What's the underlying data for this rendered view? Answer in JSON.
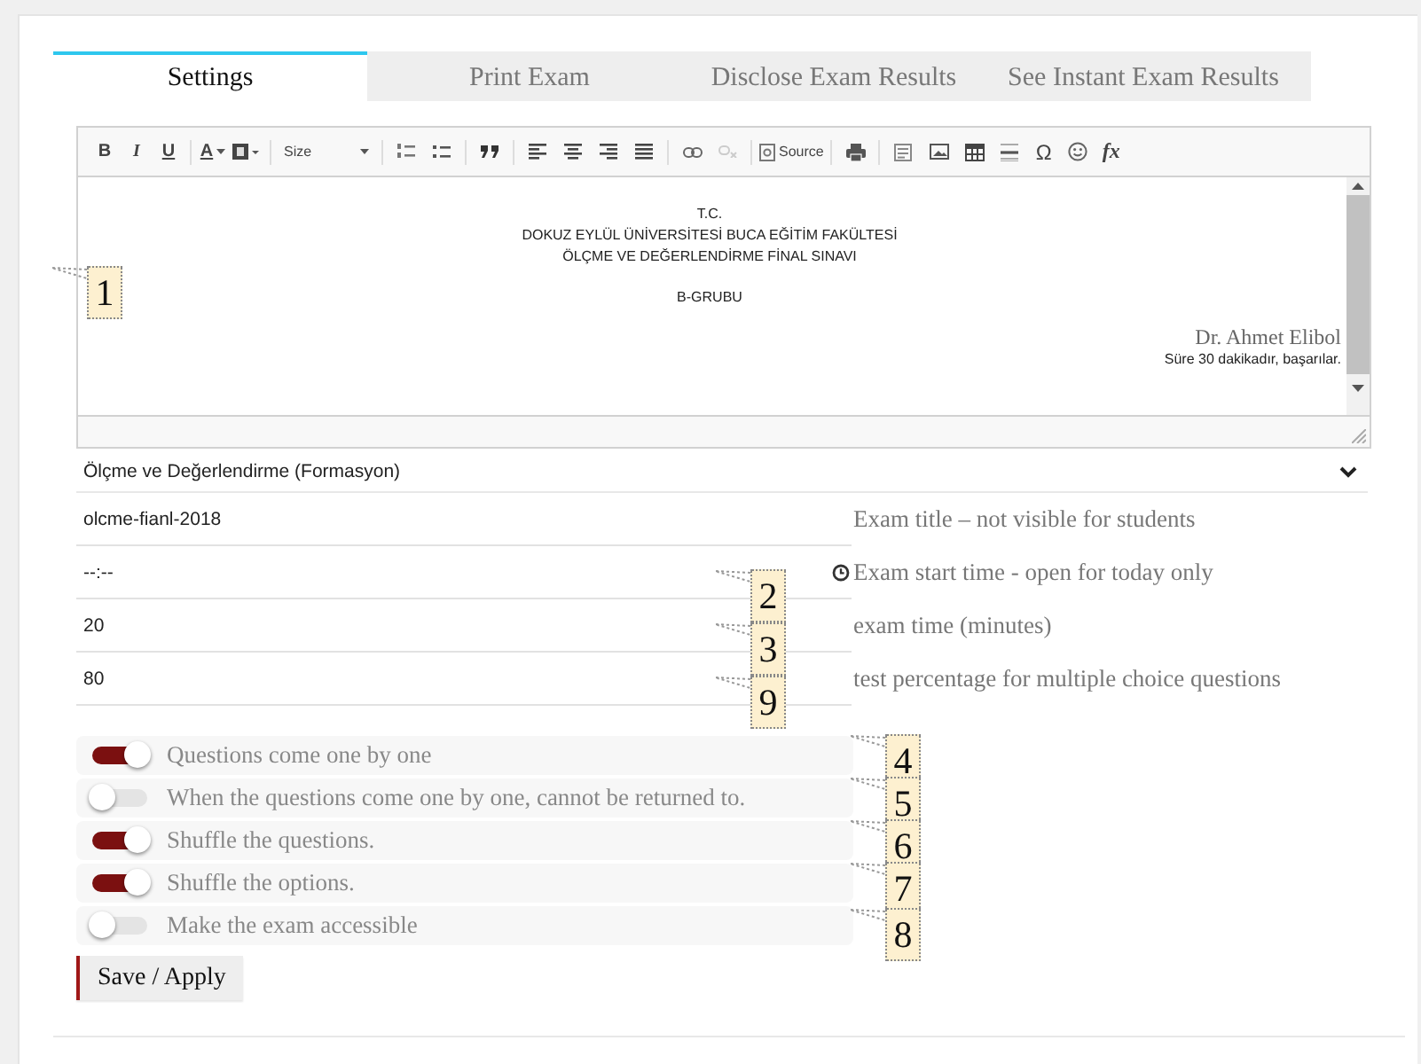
{
  "tabs": [
    {
      "label": "Settings",
      "selected": true
    },
    {
      "label": "Print Exam",
      "selected": false
    },
    {
      "label": "Disclose Exam Results",
      "selected": false
    },
    {
      "label": "See Instant Exam Results",
      "selected": false
    }
  ],
  "editor": {
    "toolbar": [
      {
        "kind": "bold",
        "label": "B"
      },
      {
        "kind": "italic",
        "label": "I"
      },
      {
        "kind": "underline",
        "label": "U"
      },
      {
        "kind": "sep"
      },
      {
        "kind": "textcolor",
        "label": "A"
      },
      {
        "kind": "bgcolor"
      },
      {
        "kind": "sep"
      },
      {
        "kind": "size",
        "label": "Size"
      },
      {
        "kind": "sep"
      },
      {
        "kind": "numlist"
      },
      {
        "kind": "bulletlist"
      },
      {
        "kind": "sep"
      },
      {
        "kind": "quote"
      },
      {
        "kind": "sep"
      },
      {
        "kind": "alignleft"
      },
      {
        "kind": "center"
      },
      {
        "kind": "alignright"
      },
      {
        "kind": "justify"
      },
      {
        "kind": "sep"
      },
      {
        "kind": "link"
      },
      {
        "kind": "unlink"
      },
      {
        "kind": "sep"
      },
      {
        "kind": "source",
        "label": "Source"
      },
      {
        "kind": "sep"
      },
      {
        "kind": "print"
      },
      {
        "kind": "sep"
      },
      {
        "kind": "template"
      },
      {
        "kind": "image"
      },
      {
        "kind": "table"
      },
      {
        "kind": "rule"
      },
      {
        "kind": "symbol",
        "label": "Ω"
      },
      {
        "kind": "smiley"
      },
      {
        "kind": "formula",
        "label": "fx"
      }
    ],
    "content": [
      {
        "kind": "center",
        "text": "T.C."
      },
      {
        "kind": "center",
        "text": "DOKUZ EYLÜL ÜNİVERSİTESİ BUCA EĞİTİM FAKÜLTESİ"
      },
      {
        "kind": "center",
        "text": "ÖLÇME VE DEĞERLENDİRME FİNAL SINAVI"
      },
      {
        "kind": "spacer"
      },
      {
        "kind": "center",
        "text": "B-GRUBU"
      },
      {
        "kind": "spacer"
      },
      {
        "kind": "signature",
        "text": "Dr. Ahmet Elibol"
      },
      {
        "kind": "right",
        "text": "Süre 30 dakikadır, başarılar."
      }
    ]
  },
  "course_select": {
    "value": "Ölçme ve Değerlendirme (Formasyon)"
  },
  "fields": [
    {
      "value": "olcme-fianl-2018",
      "hint": "Exam title – not visible for students",
      "kind": "text"
    },
    {
      "value": "--:--",
      "hint": "Exam start time - open for today only",
      "kind": "time"
    },
    {
      "value": "20",
      "hint": "exam time (minutes)",
      "kind": "text"
    },
    {
      "value": "80",
      "hint": "test percentage for multiple choice questions",
      "kind": "text"
    }
  ],
  "toggles": [
    {
      "label": "Questions come one by one",
      "on": true
    },
    {
      "label": "When the questions come one by one, cannot be returned to.",
      "on": false
    },
    {
      "label": "Shuffle the questions.",
      "on": true
    },
    {
      "label": "Shuffle the options.",
      "on": true
    },
    {
      "label": "Make the exam accessible",
      "on": false
    }
  ],
  "save_button": "Save / Apply",
  "callouts": [
    "1",
    "2",
    "3",
    "9",
    "4",
    "5",
    "6",
    "7",
    "8"
  ]
}
